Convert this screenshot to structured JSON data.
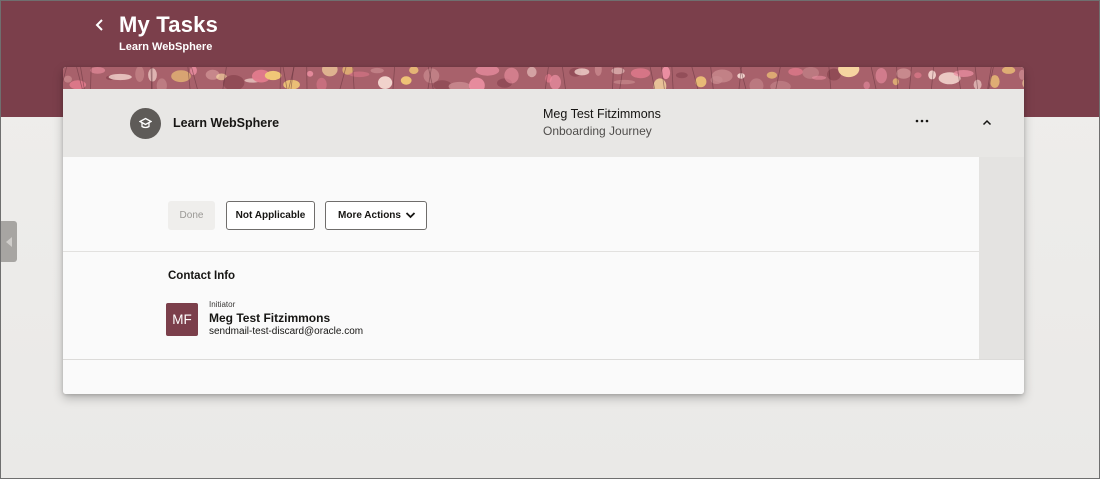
{
  "header": {
    "title": "My Tasks",
    "subtitle": "Learn WebSphere",
    "back_icon": "chevron-left-icon",
    "banner_color": "#7b3f4b"
  },
  "task": {
    "name": "Learn WebSphere",
    "icon": "graduation-cap-icon",
    "assignee": "Meg Test Fitzimmons",
    "journey": "Onboarding Journey",
    "menu_icon": "more-horizontal-icon",
    "collapse_icon": "chevron-up-icon"
  },
  "actions": {
    "done_label": "Done",
    "not_applicable_label": "Not Applicable",
    "more_actions_label": "More Actions",
    "more_actions_icon": "chevron-down-icon"
  },
  "contact": {
    "section_title": "Contact Info",
    "avatar_initials": "MF",
    "avatar_color": "#7b3f4b",
    "role": "Initiator",
    "name": "Meg Test Fitzimmons",
    "email": "sendmail-test-discard@oracle.com"
  },
  "side_tab_icon": "caret-left-icon"
}
